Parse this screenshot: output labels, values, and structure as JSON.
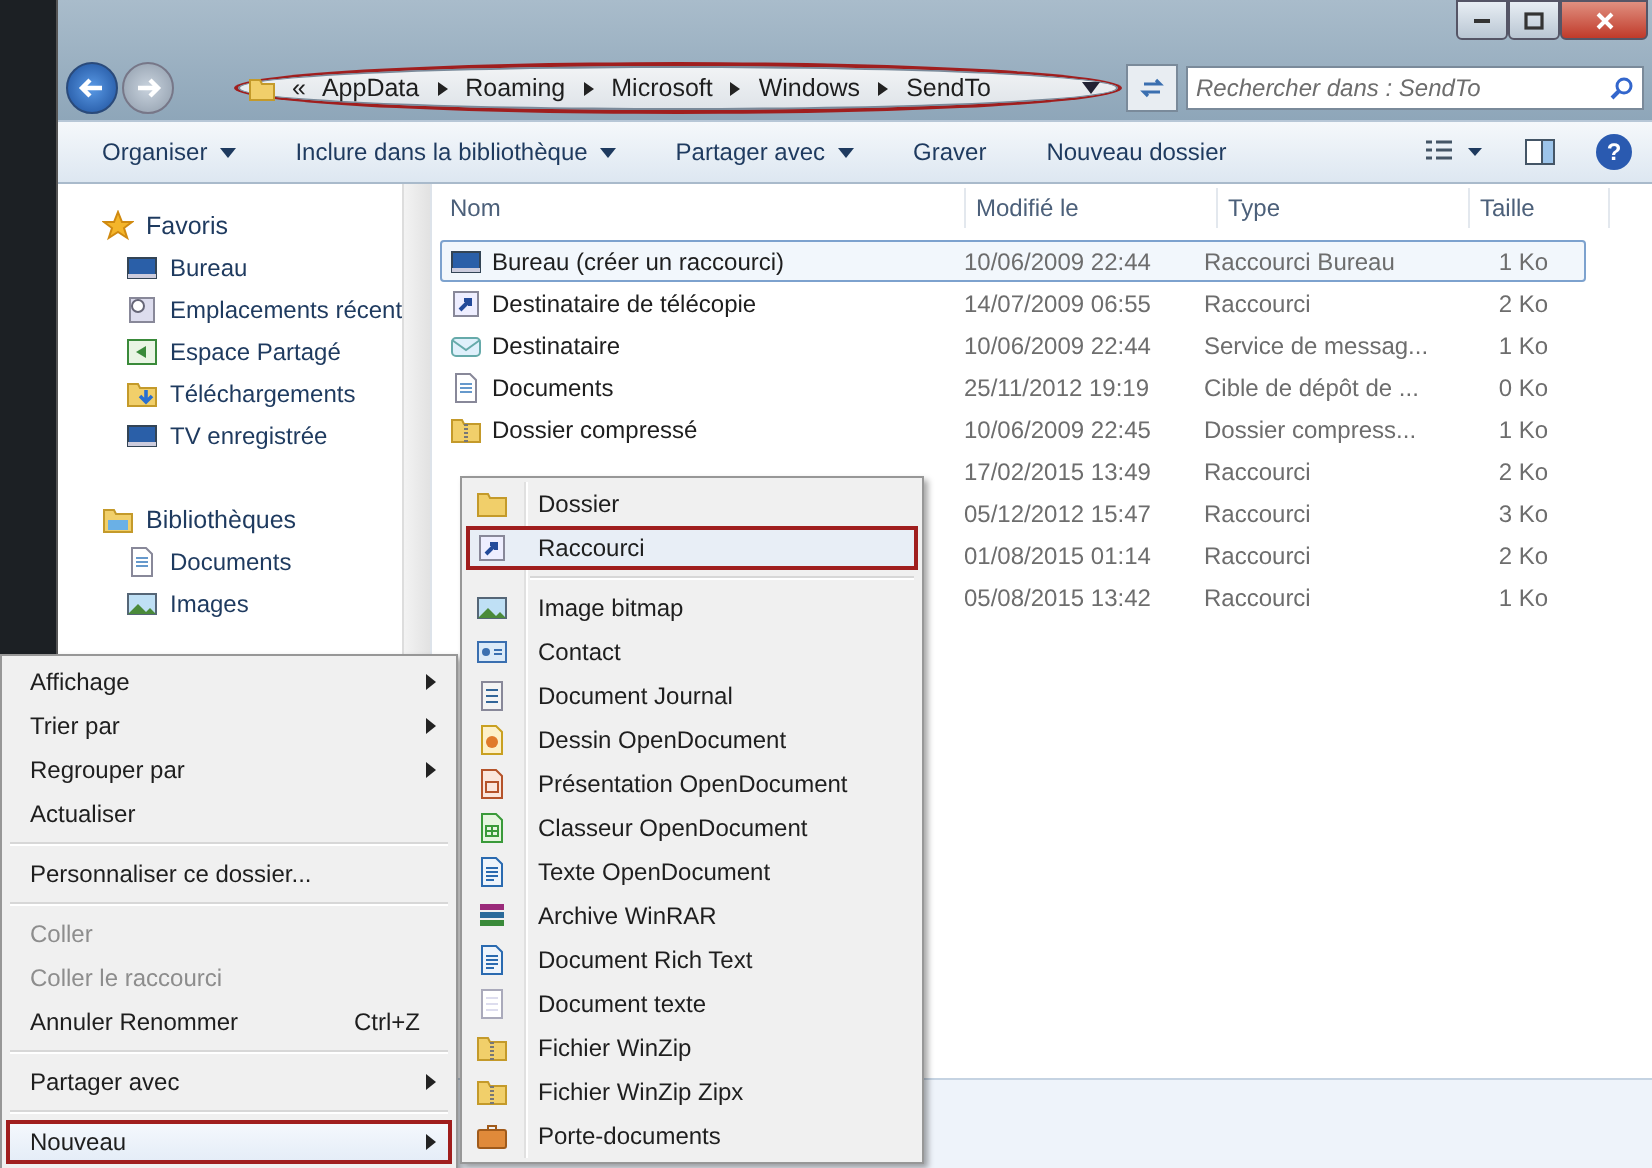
{
  "address_bar": {
    "circled": true,
    "overflow": "«",
    "path": [
      "AppData",
      "Roaming",
      "Microsoft",
      "Windows",
      "SendTo"
    ]
  },
  "search": {
    "placeholder": "Rechercher dans : SendTo"
  },
  "toolbar": {
    "items": [
      {
        "label": "Organiser",
        "dropdown": true
      },
      {
        "label": "Inclure dans la bibliothèque",
        "dropdown": true
      },
      {
        "label": "Partager avec",
        "dropdown": true
      },
      {
        "label": "Graver",
        "dropdown": false
      },
      {
        "label": "Nouveau dossier",
        "dropdown": false
      }
    ],
    "help": "?"
  },
  "sidebar": {
    "groups": [
      {
        "label": "Favoris",
        "kind": "star",
        "children": [
          {
            "label": "Bureau",
            "kind": "desktop"
          },
          {
            "label": "Emplacements récent",
            "kind": "recent"
          },
          {
            "label": "Espace Partagé",
            "kind": "share"
          },
          {
            "label": "Téléchargements",
            "kind": "download"
          },
          {
            "label": "TV enregistrée",
            "kind": "desktop"
          }
        ]
      },
      {
        "label": "Bibliothèques",
        "kind": "library",
        "children": [
          {
            "label": "Documents",
            "kind": "document"
          },
          {
            "label": "Images",
            "kind": "image"
          }
        ]
      }
    ]
  },
  "table": {
    "columns": [
      "Nom",
      "Modifié le",
      "Type",
      "Taille"
    ],
    "rows": [
      {
        "name": "Bureau (créer un raccourci)",
        "modified": "10/06/2009 22:44",
        "type": "Raccourci Bureau",
        "size": "1 Ko",
        "selected": true,
        "kind": "desktop"
      },
      {
        "name": "Destinataire de télécopie",
        "modified": "14/07/2009 06:55",
        "type": "Raccourci",
        "size": "2 Ko",
        "selected": false,
        "kind": "shortcut"
      },
      {
        "name": "Destinataire",
        "modified": "10/06/2009 22:44",
        "type": "Service de messag...",
        "size": "1 Ko",
        "selected": false,
        "kind": "mail"
      },
      {
        "name": "Documents",
        "modified": "25/11/2012 19:19",
        "type": "Cible de dépôt de ...",
        "size": "0 Ko",
        "selected": false,
        "kind": "document"
      },
      {
        "name": "Dossier compressé",
        "modified": "10/06/2009 22:45",
        "type": "Dossier compress...",
        "size": "1 Ko",
        "selected": false,
        "kind": "zip"
      },
      {
        "modified": "17/02/2015 13:49",
        "type": "Raccourci",
        "size": "2 Ko",
        "selected": false
      },
      {
        "modified": "05/12/2012 15:47",
        "type": "Raccourci",
        "size": "3 Ko",
        "selected": false
      },
      {
        "modified": "01/08/2015 01:14",
        "type": "Raccourci",
        "size": "2 Ko",
        "selected": false
      },
      {
        "modified": "05/08/2015 13:42",
        "type": "Raccourci",
        "size": "1 Ko",
        "selected": false
      }
    ]
  },
  "context_menu": {
    "items": [
      {
        "kind": "item",
        "label": "Affichage",
        "submenu": true,
        "disabled": false,
        "selected": false
      },
      {
        "kind": "item",
        "label": "Trier par",
        "submenu": true,
        "disabled": false,
        "selected": false
      },
      {
        "kind": "item",
        "label": "Regrouper par",
        "submenu": true,
        "disabled": false,
        "selected": false
      },
      {
        "kind": "item",
        "label": "Actualiser",
        "submenu": false,
        "disabled": false,
        "selected": false
      },
      {
        "kind": "separator"
      },
      {
        "kind": "item",
        "label": "Personnaliser ce dossier...",
        "submenu": false,
        "disabled": false,
        "selected": false
      },
      {
        "kind": "separator"
      },
      {
        "kind": "item",
        "label": "Coller",
        "submenu": false,
        "disabled": true,
        "selected": false
      },
      {
        "kind": "item",
        "label": "Coller le raccourci",
        "submenu": false,
        "disabled": true,
        "selected": false
      },
      {
        "kind": "item",
        "label": "Annuler Renommer",
        "shortcut": "Ctrl+Z",
        "submenu": false,
        "disabled": false,
        "selected": false
      },
      {
        "kind": "separator"
      },
      {
        "kind": "item",
        "label": "Partager avec",
        "submenu": true,
        "disabled": false,
        "selected": false
      },
      {
        "kind": "separator"
      },
      {
        "kind": "item",
        "label": "Nouveau",
        "submenu": true,
        "disabled": false,
        "selected": true
      }
    ]
  },
  "submenu": {
    "items": [
      {
        "kind": "folder",
        "label": "Dossier",
        "selected": false
      },
      {
        "kind": "shortcut",
        "label": "Raccourci",
        "selected": true
      },
      {
        "kind": "separator"
      },
      {
        "kind": "image",
        "label": "Image bitmap",
        "selected": false
      },
      {
        "kind": "contact",
        "label": "Contact",
        "selected": false
      },
      {
        "kind": "journal",
        "label": "Document Journal",
        "selected": false
      },
      {
        "kind": "draw",
        "label": "Dessin OpenDocument",
        "selected": false
      },
      {
        "kind": "slides",
        "label": "Présentation OpenDocument",
        "selected": false
      },
      {
        "kind": "sheet",
        "label": "Classeur OpenDocument",
        "selected": false
      },
      {
        "kind": "text",
        "label": "Texte OpenDocument",
        "selected": false
      },
      {
        "kind": "archive",
        "label": "Archive WinRAR",
        "selected": false
      },
      {
        "kind": "text",
        "label": "Document Rich Text",
        "selected": false
      },
      {
        "kind": "plain",
        "label": "Document texte",
        "selected": false
      },
      {
        "kind": "zip",
        "label": "Fichier WinZip",
        "selected": false
      },
      {
        "kind": "zip",
        "label": "Fichier WinZip Zipx",
        "selected": false
      },
      {
        "kind": "briefcase",
        "label": "Porte-documents",
        "selected": false
      }
    ]
  }
}
